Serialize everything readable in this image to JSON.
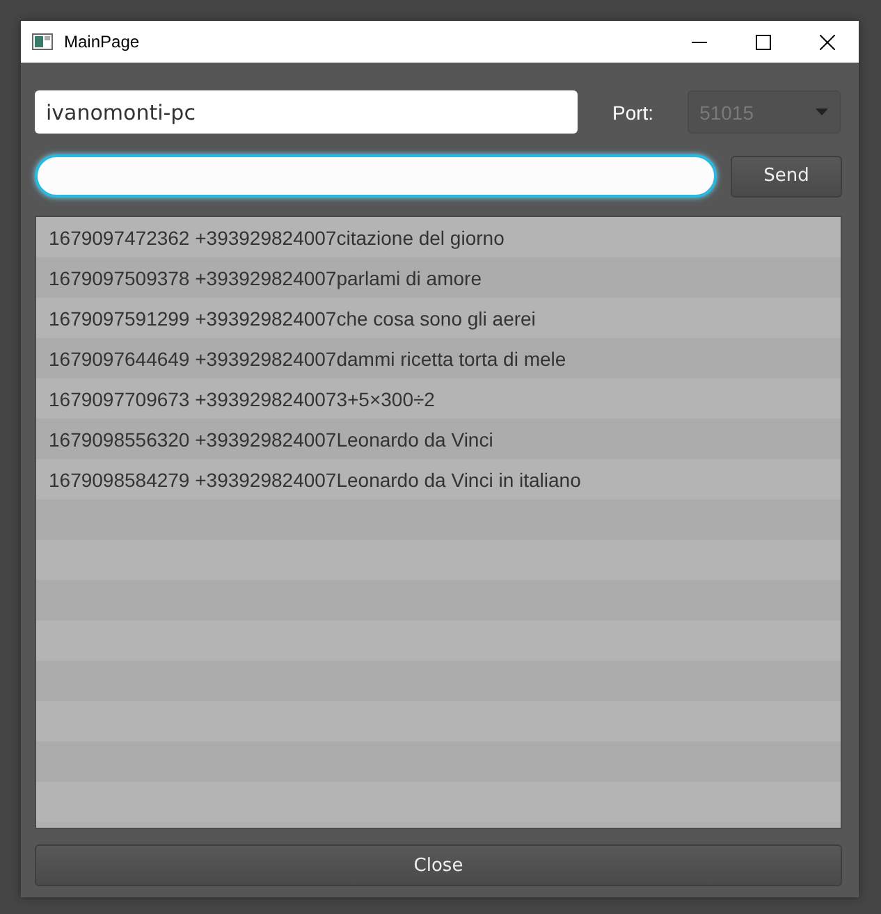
{
  "window": {
    "title": "MainPage"
  },
  "host_field": {
    "value": "ivanomonti-pc"
  },
  "port": {
    "label": "Port:",
    "value": "51015",
    "disabled": true
  },
  "message_field": {
    "focused": true
  },
  "send_button": {
    "label": "Send"
  },
  "messages": [
    {
      "text": "1679097472362 +393929824007citazione del giorno"
    },
    {
      "text": "1679097509378 +393929824007parlami di amore"
    },
    {
      "text": "1679097591299 +393929824007che cosa sono gli aerei"
    },
    {
      "text": "1679097644649 +393929824007dammi ricetta torta di mele"
    },
    {
      "text": "1679097709673 +3939298240073+5×300÷2"
    },
    {
      "text": "1679098556320 +393929824007Leonardo da Vinci"
    },
    {
      "text": "1679098584279 +393929824007Leonardo da Vinci in italiano"
    }
  ],
  "close_button": {
    "label": "Close"
  }
}
